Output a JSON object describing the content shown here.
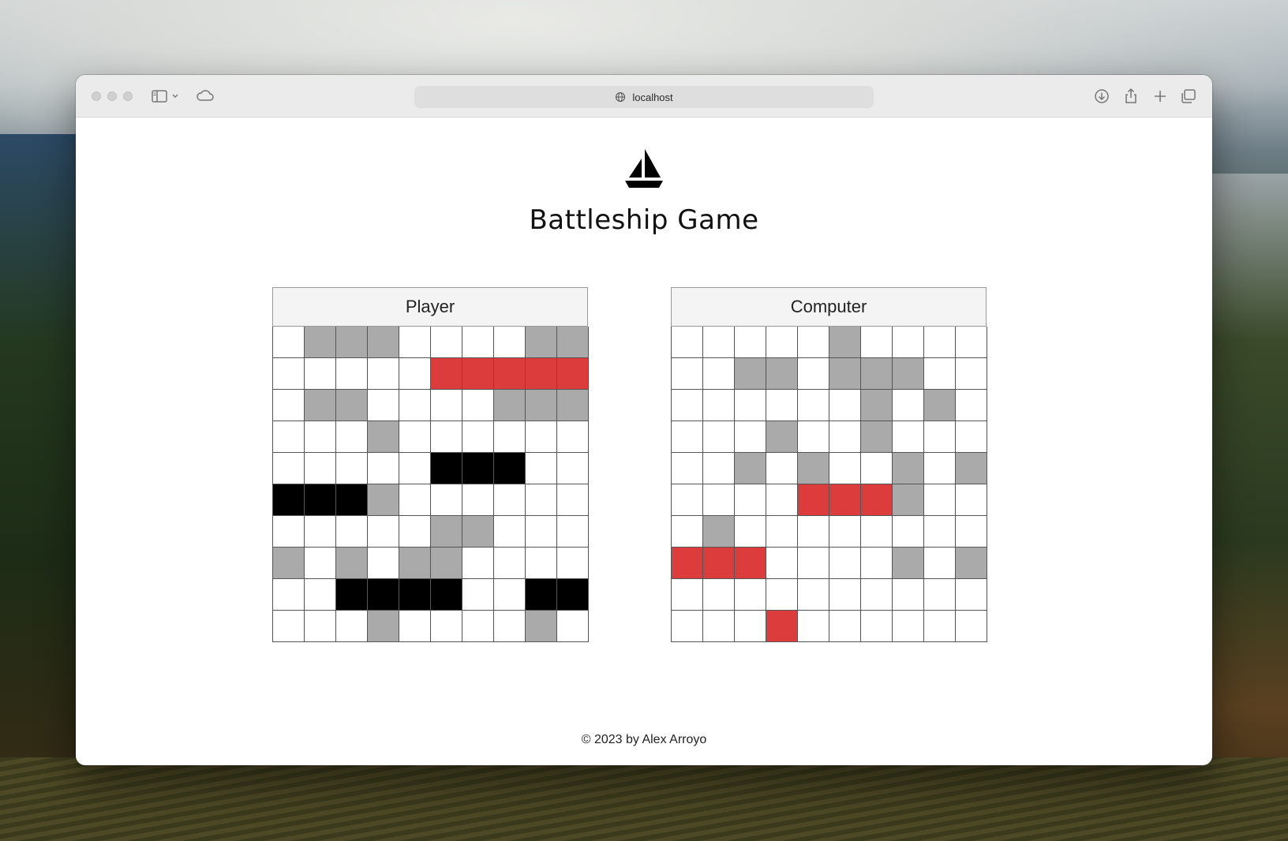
{
  "browser": {
    "url": "localhost",
    "icons": [
      "sidebar-icon",
      "chevron-down-icon",
      "cloud-icon",
      "download-icon",
      "share-icon",
      "plus-icon",
      "tabs-icon"
    ]
  },
  "app": {
    "title": "Battleship Game",
    "logo_icon": "sailboat-icon",
    "footer": "© 2023 by Alex Arroyo"
  },
  "legend_colors": {
    "miss": "#aaaaaa",
    "hit": "#dc3c3c",
    "ship": "#000000",
    "empty": "#ffffff"
  },
  "boards": [
    {
      "label": "Player",
      "rows": [
        "ommmoooommm",
        "oooooHHHHHx",
        "ommoooommmx",
        "ooomoooooomx",
        "oooooSSSoox",
        "SSSmoooooox",
        "ooooommoooox",
        "momommoooox",
        "ooSSSSooSSx",
        "ooomoooomoox"
      ]
    },
    {
      "label": "Computer",
      "rows": [
        "ooooomoooo",
        "oommommmoo",
        "oooooomomoo",
        "ooomoomooo",
        "oomomoomom",
        "ooooHHHmoo",
        "omoooooooo",
        "HHHoooomomo",
        "oooooooooo",
        "oooHoooooo"
      ]
    }
  ]
}
